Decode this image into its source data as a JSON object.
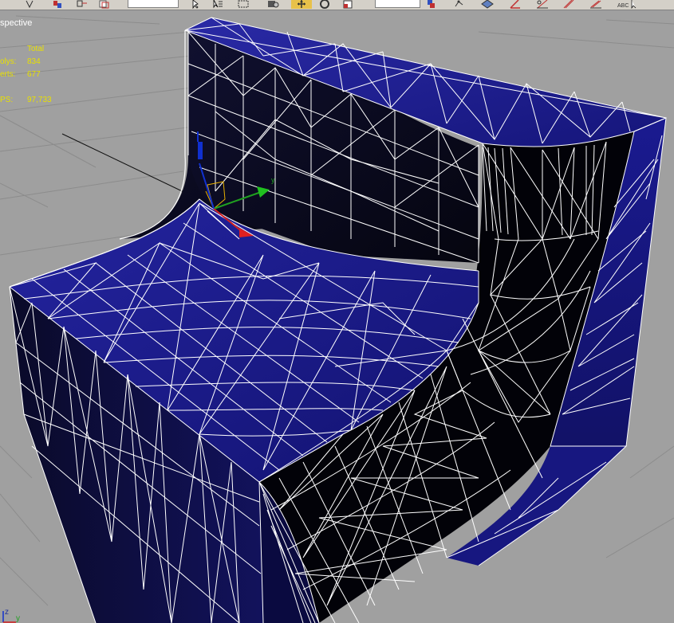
{
  "toolbar": {
    "icons": [
      "vertex-icon",
      "select-and-link-icon",
      "bind-to-spacewarp-icon",
      "selection-filter-dropdown",
      "select-object-icon",
      "select-by-name-icon",
      "rectangular-selection-icon",
      "window-crossing-icon",
      "select-and-move-icon",
      "select-and-rotate-icon",
      "select-and-scale-icon",
      "reference-coordinate-dropdown",
      "use-pivot-center-icon",
      "select-and-manipulate-icon",
      "snap-toggle-icon",
      "angle-snap-icon",
      "percent-snap-icon",
      "spinner-snap-icon",
      "edit-named-selection-icon"
    ],
    "active_tool": "select-and-move-icon"
  },
  "viewport": {
    "label": "spective",
    "stats": {
      "header": "Total",
      "polys_label": "olys:",
      "polys_value": "834",
      "verts_label": "erts:",
      "verts_value": "677",
      "fps_label": "PS:",
      "fps_value": "97,733"
    },
    "gizmo_axis_y": "y",
    "corner_axis_z": "z",
    "corner_axis_y": "y"
  },
  "colors": {
    "viewport_bg": "#a0a0a0",
    "grid": "#8a8a8a",
    "face_blue": "#1c1c9a",
    "face_dark": "#080820",
    "face_black": "#000000",
    "wire": "#ffffff",
    "stats_text": "#e8e000"
  }
}
